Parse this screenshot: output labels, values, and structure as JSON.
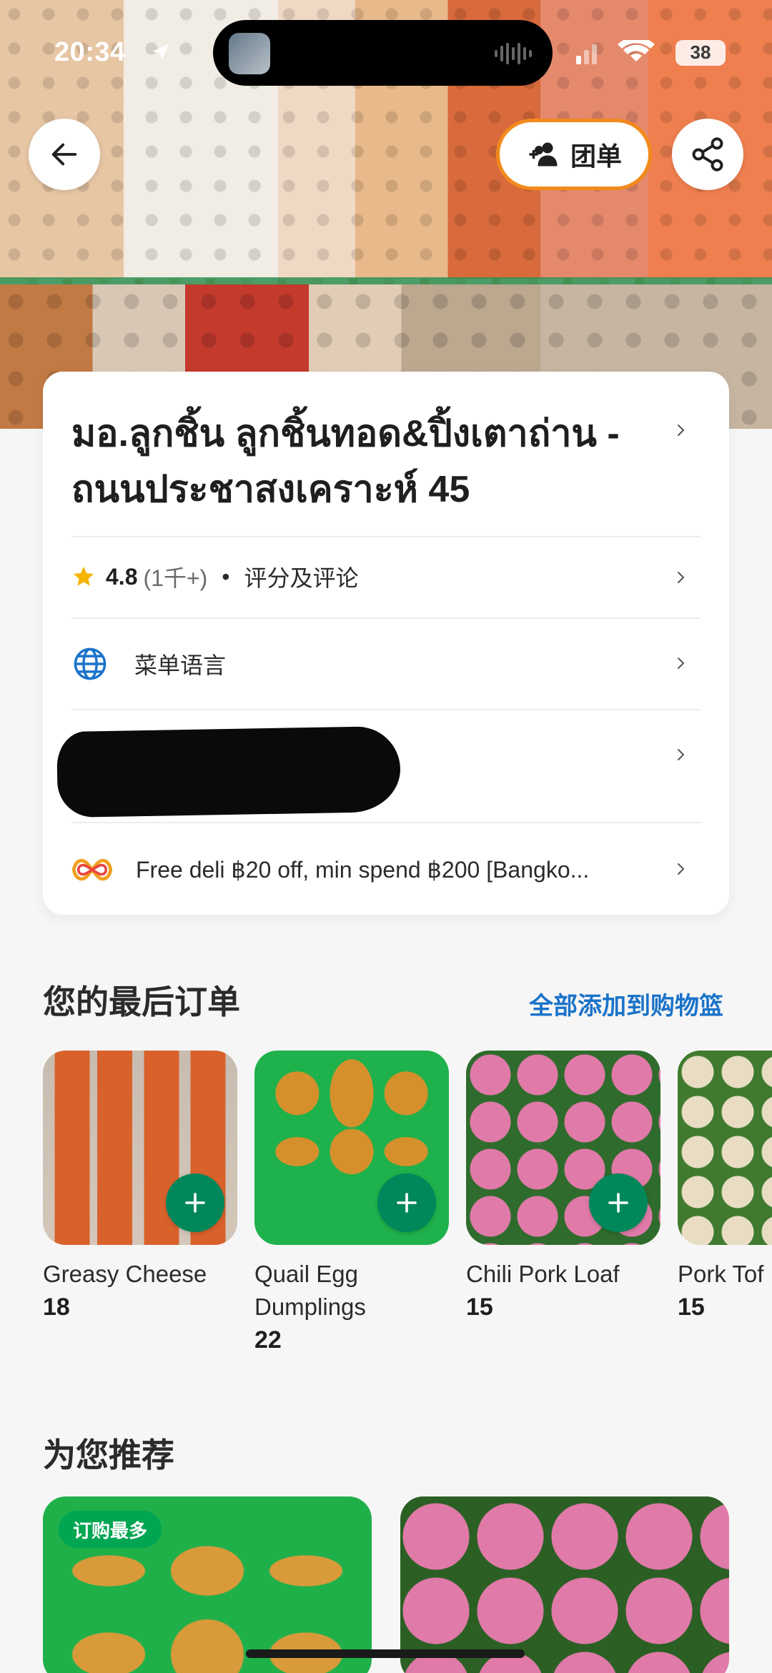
{
  "status_bar": {
    "time": "20:34",
    "battery": "38"
  },
  "header": {
    "group_order_label": "团单"
  },
  "restaurant": {
    "name": "มอ.ลูกชิ้น ลูกชิ้นทอด&ปิ้งเตาถ่าน - ถนนประชาสงเคราะห์ 45",
    "rating": "4.8",
    "rating_count": "(1千+)",
    "separator": "•",
    "reviews_label": "评分及评论",
    "menu_language_label": "菜单语言",
    "promo_text": "Free deli ฿20 off, min spend ฿200 [Bangko..."
  },
  "last_orders": {
    "title": "您的最后订单",
    "add_all_label": "全部添加到购物篮",
    "items": [
      {
        "name": "Greasy Cheese",
        "price": "18"
      },
      {
        "name": "Quail Egg Dumplings",
        "price": "22"
      },
      {
        "name": "Chili Pork Loaf",
        "price": "15"
      },
      {
        "name": "Pork Tof",
        "price": "15"
      }
    ]
  },
  "recommended": {
    "title": "为您推荐",
    "badge": "订购最多"
  },
  "colors": {
    "accent_orange": "#f28a1c",
    "add_green": "#00875a",
    "link_blue": "#1a73c9",
    "star": "#f5b400"
  }
}
